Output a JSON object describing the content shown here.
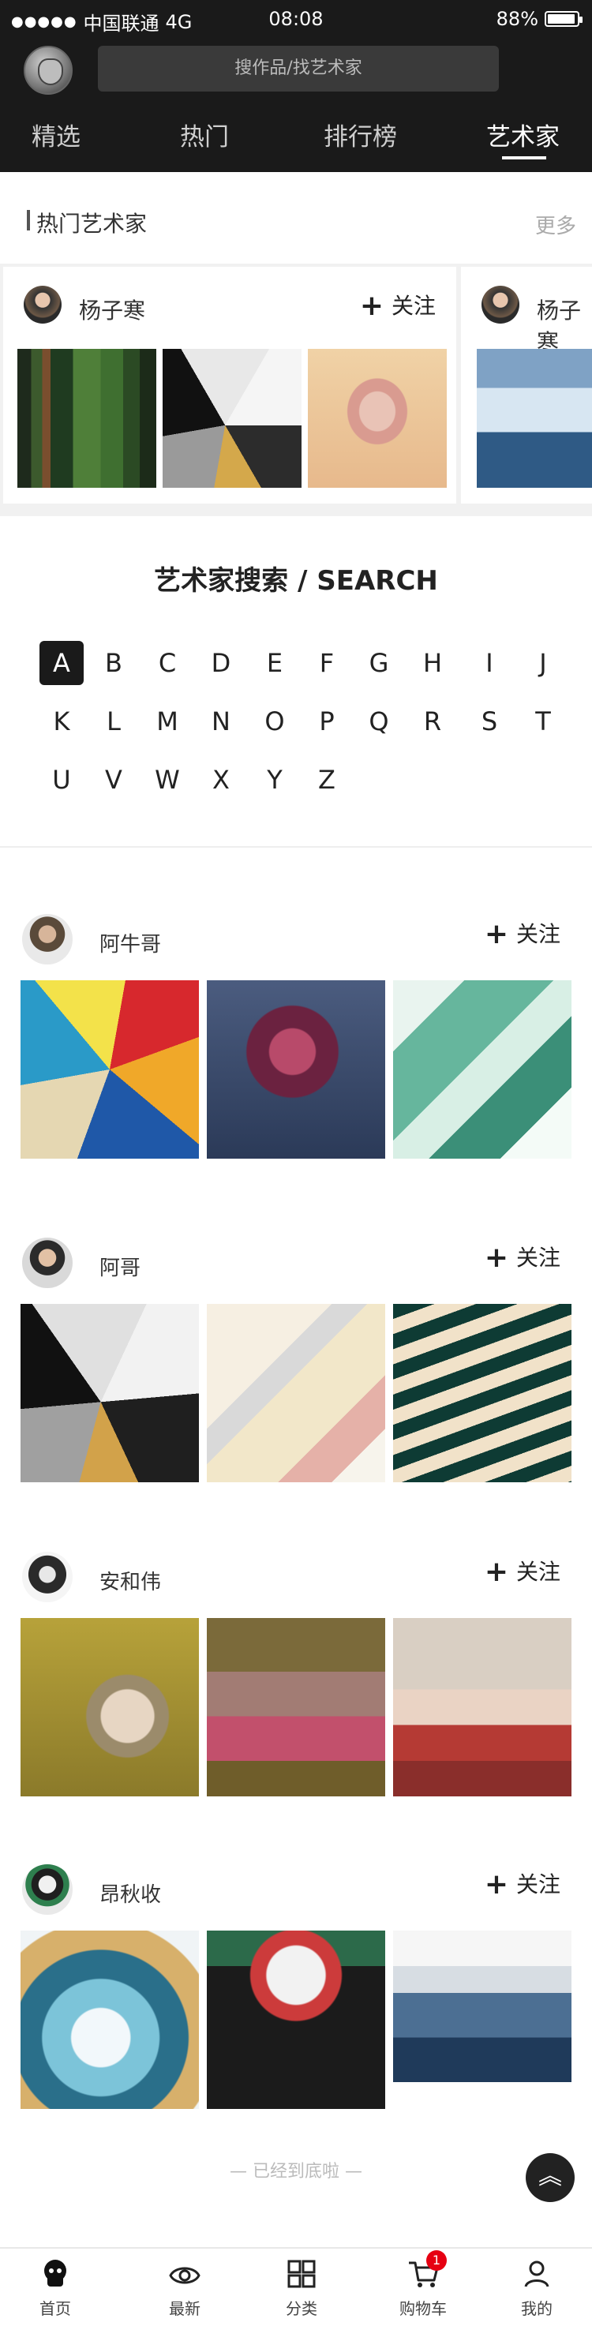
{
  "status": {
    "carrier": "中国联通",
    "network": "4G",
    "time": "08:08",
    "battery": "88%"
  },
  "search": {
    "placeholder": "搜作品/找艺术家"
  },
  "tabs": [
    {
      "label": "精选"
    },
    {
      "label": "热门"
    },
    {
      "label": "排行榜"
    },
    {
      "label": "艺术家"
    }
  ],
  "hot": {
    "title": "热门艺术家",
    "more": "更多",
    "cards": [
      {
        "name": "杨子寒",
        "follow": "关注"
      },
      {
        "name": "杨子寒"
      }
    ]
  },
  "artist_search": {
    "title": "艺术家搜索 / SEARCH",
    "letters": [
      "A",
      "B",
      "C",
      "D",
      "E",
      "F",
      "G",
      "H",
      "I",
      "J",
      "K",
      "L",
      "M",
      "N",
      "O",
      "P",
      "Q",
      "R",
      "S",
      "T",
      "U",
      "V",
      "W",
      "X",
      "Y",
      "Z"
    ],
    "selected": "A"
  },
  "artists": [
    {
      "name": "阿牛哥",
      "follow": "关注"
    },
    {
      "name": "阿哥",
      "follow": "关注"
    },
    {
      "name": "安和伟",
      "follow": "关注"
    },
    {
      "name": "昂秋收",
      "follow": "关注"
    }
  ],
  "footer": {
    "end_text": "— 已经到底啦 —"
  },
  "bottom_nav": [
    {
      "label": "首页"
    },
    {
      "label": "最新"
    },
    {
      "label": "分类"
    },
    {
      "label": "购物车",
      "badge": "1"
    },
    {
      "label": "我的"
    }
  ],
  "colors": {
    "header_bg": "#1a1a1a",
    "badge_red": "#e60012"
  },
  "icons": [
    "signal-dots-icon",
    "battery-icon",
    "logo",
    "follow-plus-icon",
    "back-to-top-icon",
    "home-icon",
    "eye-icon",
    "grid-icon",
    "cart-icon",
    "user-icon"
  ]
}
